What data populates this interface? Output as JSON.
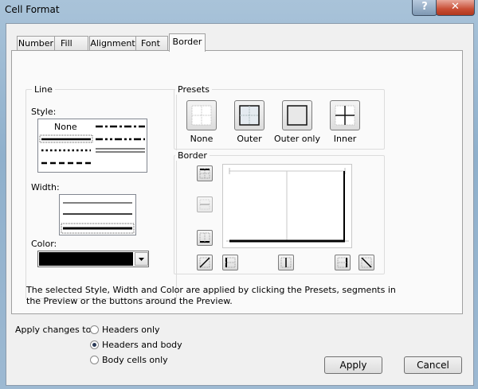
{
  "window": {
    "title": "Cell Format",
    "help_glyph": "?",
    "close_glyph": "✕"
  },
  "tabs": [
    {
      "label": "Number"
    },
    {
      "label": "Fill"
    },
    {
      "label": "Alignment"
    },
    {
      "label": "Font"
    },
    {
      "label": "Border",
      "active": true
    }
  ],
  "line_group": {
    "title": "Line",
    "style_label": "Style:",
    "style_none": "None",
    "width_label": "Width:",
    "color_label": "Color:",
    "color_value": "#000000"
  },
  "presets_group": {
    "title": "Presets",
    "items": [
      {
        "label": "None",
        "icon": "preset-none-icon"
      },
      {
        "label": "Outer",
        "icon": "preset-outer-icon"
      },
      {
        "label": "Outer only",
        "icon": "preset-outer-only-icon"
      },
      {
        "label": "Inner",
        "icon": "preset-inner-icon"
      }
    ]
  },
  "border_group": {
    "title": "Border"
  },
  "info_text": "The selected Style, Width and Color are applied by clicking the Presets, segments in the Preview or the buttons around the Preview.",
  "apply_changes": {
    "label": "Apply changes to:",
    "options": [
      {
        "label": "Headers only",
        "selected": false
      },
      {
        "label": "Headers and body",
        "selected": true
      },
      {
        "label": "Body cells only",
        "selected": false
      }
    ]
  },
  "buttons": {
    "apply": "Apply",
    "cancel": "Cancel"
  }
}
